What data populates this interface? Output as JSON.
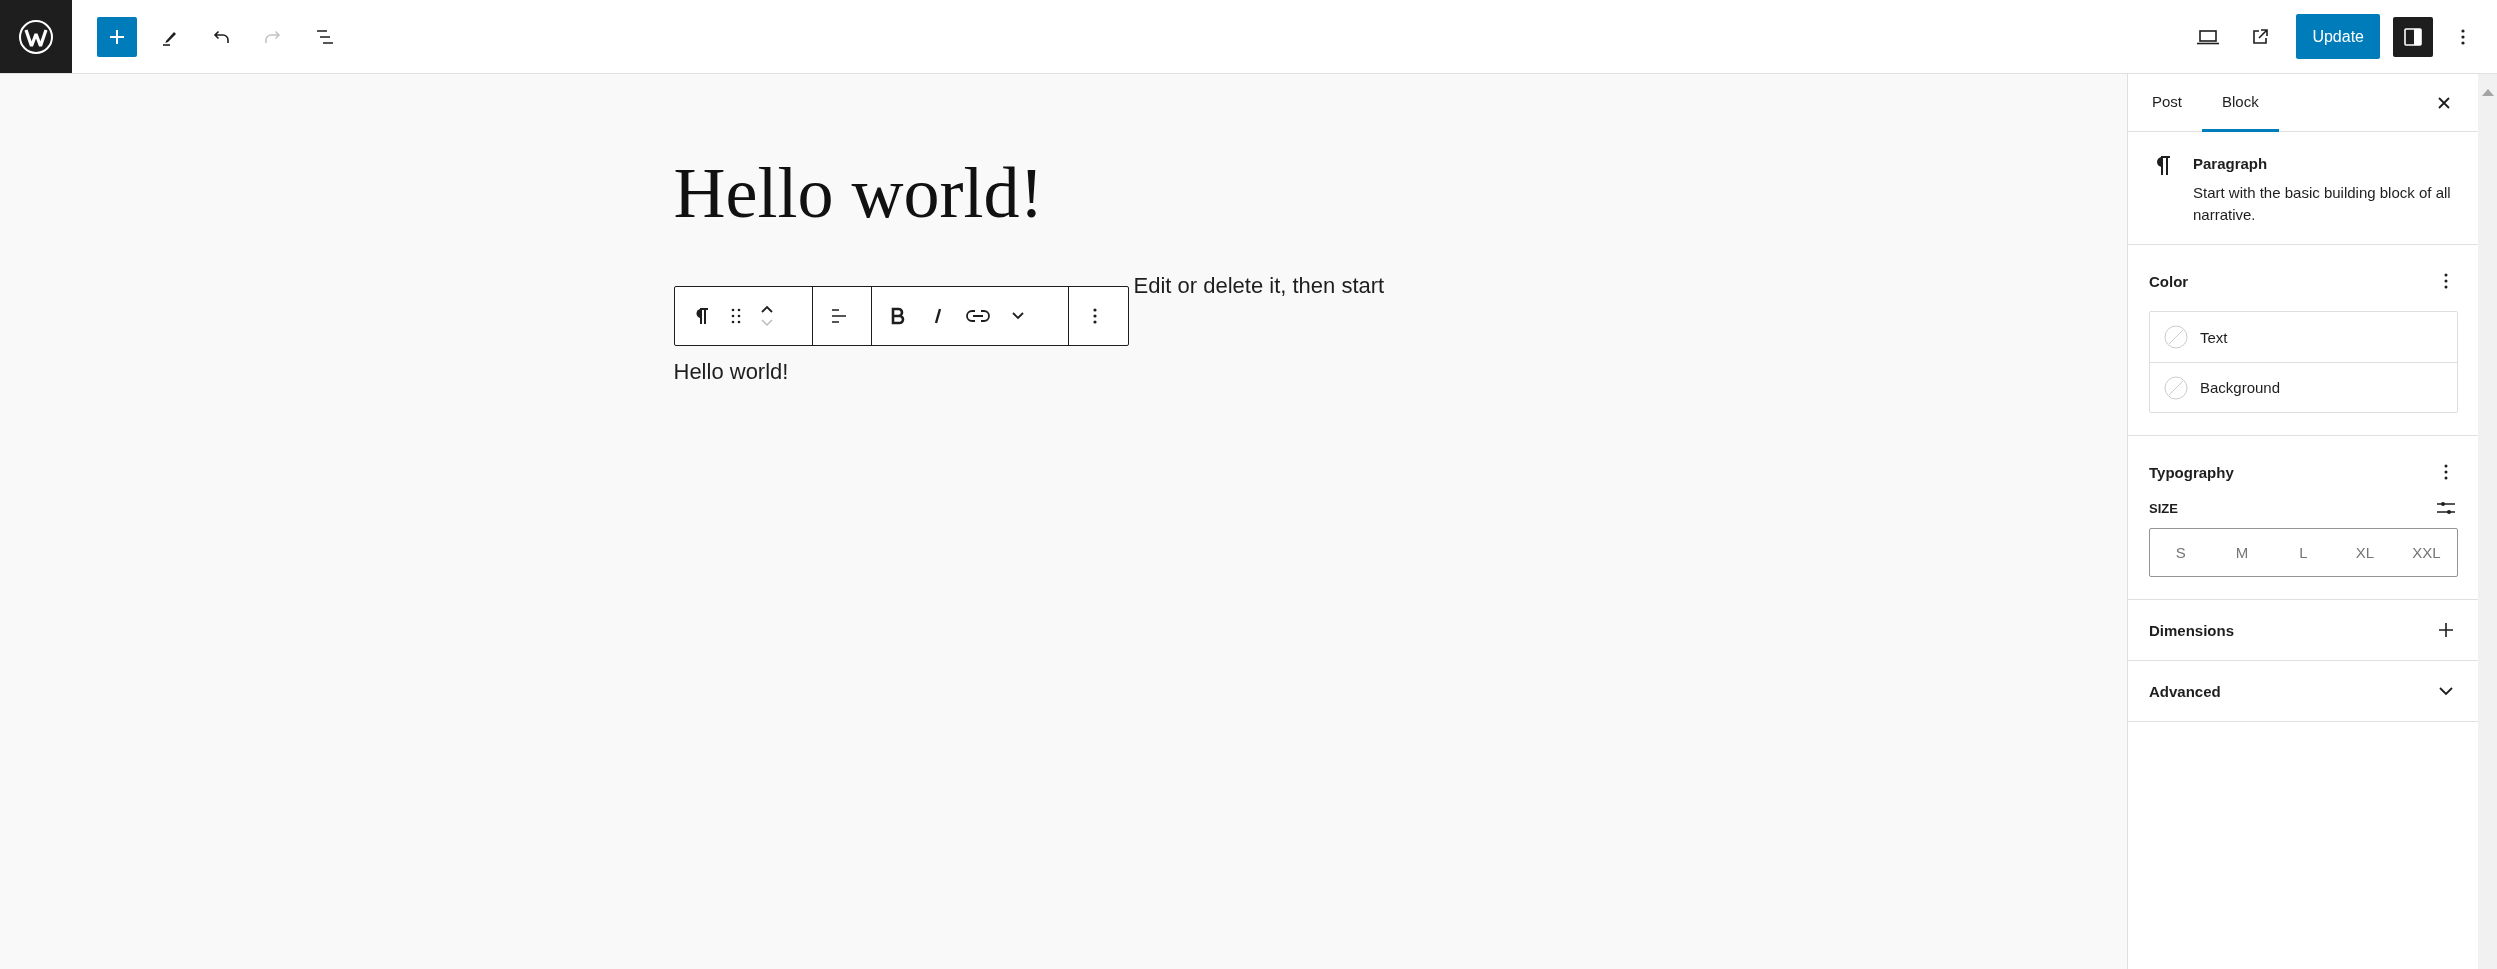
{
  "top_bar": {
    "update_button": "Update",
    "redo_disabled": true,
    "settings_pressed": true
  },
  "editor": {
    "title": "Hello world!",
    "paragraphs": [
      "Edit or delete it, then start",
      "Hello world!"
    ]
  },
  "sidebar": {
    "tabs": [
      {
        "label": "Post",
        "selected": false
      },
      {
        "label": "Block",
        "selected": true
      }
    ],
    "block_card": {
      "title": "Paragraph",
      "description": "Start with the basic building block of all narrative."
    },
    "color": {
      "title": "Color",
      "items": [
        "Text",
        "Background"
      ]
    },
    "typography": {
      "title": "Typography",
      "size_label": "SIZE",
      "sizes": [
        {
          "label": "S",
          "selected": false
        },
        {
          "label": "M",
          "selected": false
        },
        {
          "label": "L",
          "selected": false
        },
        {
          "label": "XL",
          "selected": false
        },
        {
          "label": "XXL",
          "selected": false
        }
      ]
    },
    "panels": [
      {
        "title": "Dimensions",
        "kind": "add"
      },
      {
        "title": "Advanced",
        "kind": "toggle",
        "expanded": false
      }
    ]
  }
}
